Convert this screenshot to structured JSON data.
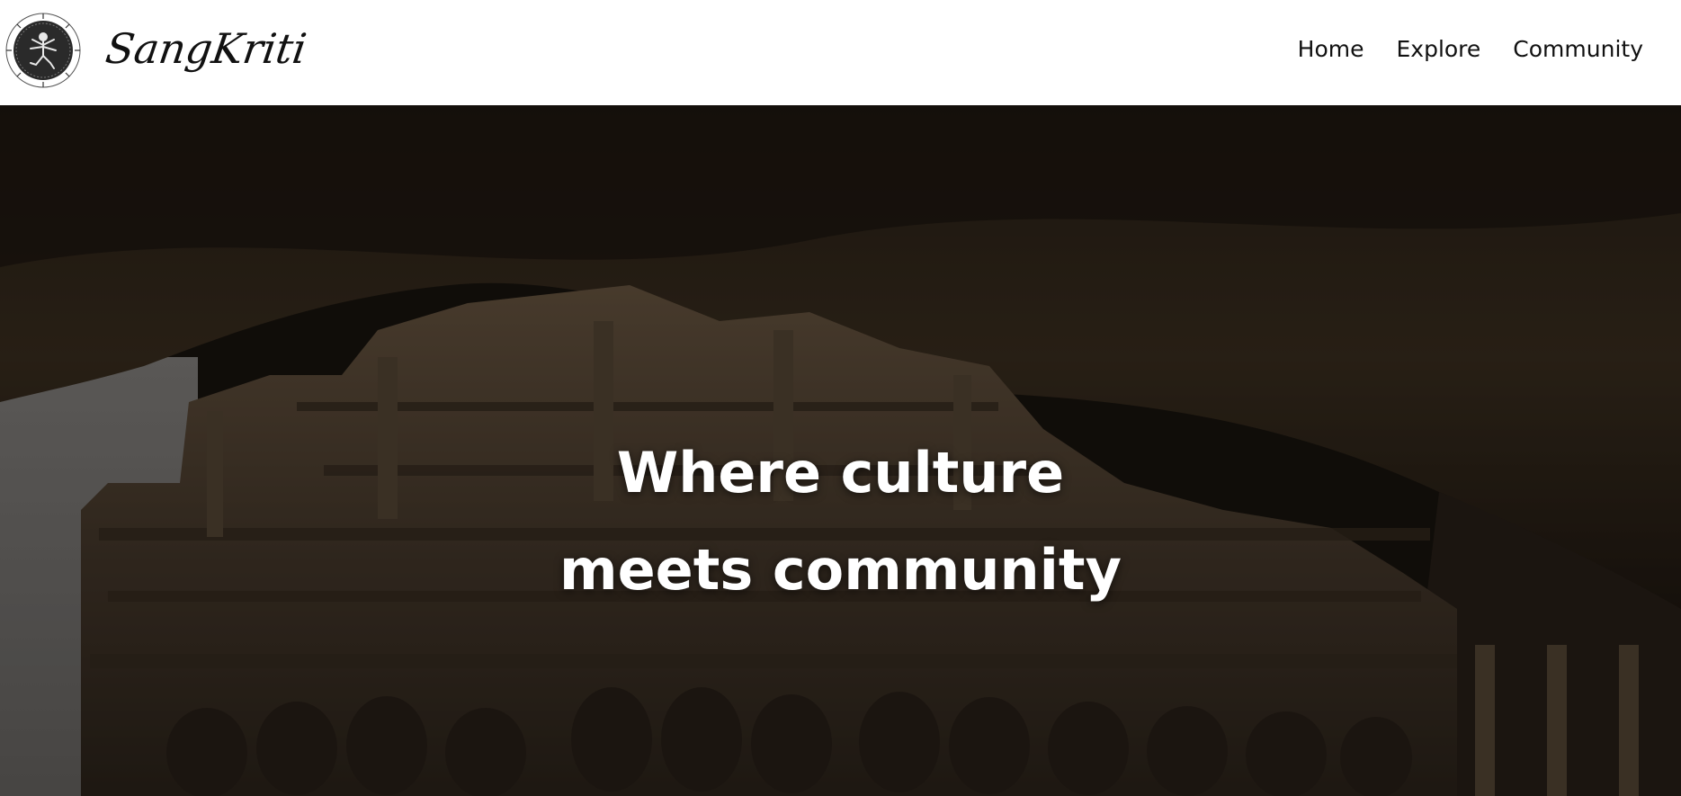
{
  "brand": {
    "logo_icon": "dancing-figure-emblem-icon",
    "name": "SangKriti"
  },
  "nav": {
    "items": [
      {
        "label": "Home"
      },
      {
        "label": "Explore"
      },
      {
        "label": "Community"
      }
    ]
  },
  "hero": {
    "background_image": "rock-cut-temple-cave-photo",
    "heading_line1": "Where culture",
    "heading_line2": "meets community",
    "overlay_color": "#000000"
  }
}
